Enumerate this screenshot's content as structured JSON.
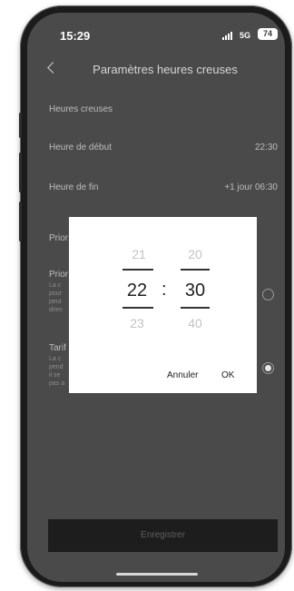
{
  "status": {
    "time": "15:29",
    "network": "5G",
    "battery": "74"
  },
  "header": {
    "title": "Paramètres heures creuses"
  },
  "rows": {
    "heures_creuses": {
      "label": "Heures creuses"
    },
    "debut": {
      "label": "Heure de début",
      "value": "22:30"
    },
    "fin": {
      "label": "Heure de fin",
      "value": "+1 jour 06:30"
    },
    "prior1": {
      "label": "Prior"
    },
    "prior2": {
      "label": "Prior",
      "desc": [
        "La c",
        "pour",
        "peut",
        "direc"
      ]
    },
    "tarif": {
      "label": "Tarif",
      "desc": [
        "La c",
        "pend",
        "il se",
        "pas a"
      ]
    }
  },
  "picker": {
    "hours": [
      "21",
      "22",
      "23"
    ],
    "minutes": [
      "20",
      "30",
      "40"
    ],
    "separator": ":",
    "cancel": "Annuler",
    "ok": "OK"
  },
  "save_button": "Enregistrer",
  "colors": {
    "screen_bg": "#4a4a4a",
    "dialog_bg": "#ffffff",
    "save_bg": "#1d1d1d"
  }
}
